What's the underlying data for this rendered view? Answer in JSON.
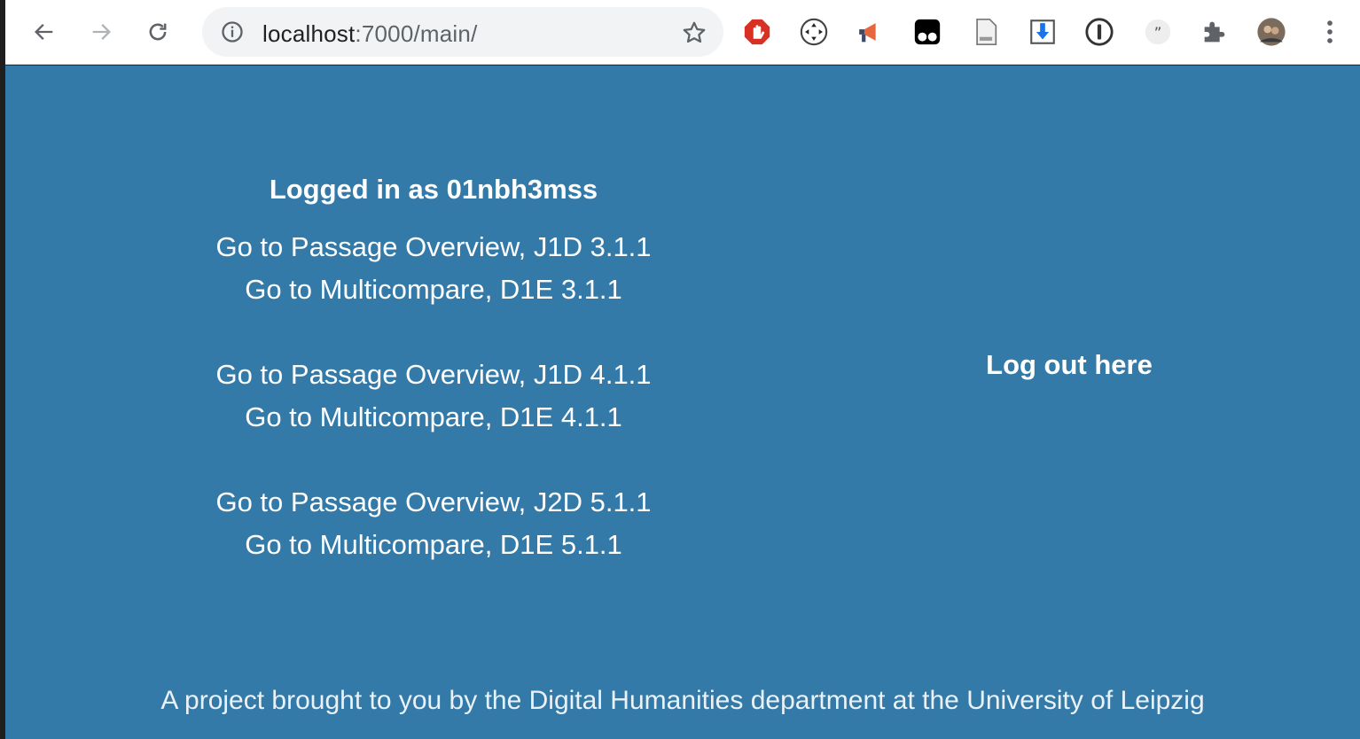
{
  "browser": {
    "url_host": "localhost",
    "url_path": ":7000/main/",
    "extensions": [
      "adblock-icon",
      "move-icon",
      "megaphone-icon",
      "tampermonkey-icon",
      "document-icon",
      "download-icon",
      "password-manager-icon",
      "quote-icon",
      "puzzle-icon",
      "profile-avatar-icon",
      "menu-icon"
    ]
  },
  "page": {
    "logged_in_text": "Logged in as 01nbh3mss",
    "link_groups": [
      {
        "passage": "Go to Passage Overview, J1D 3.1.1",
        "multicompare": "Go to Multicompare, D1E 3.1.1"
      },
      {
        "passage": "Go to Passage Overview, J1D 4.1.1",
        "multicompare": "Go to Multicompare, D1E 4.1.1"
      },
      {
        "passage": "Go to Passage Overview, J2D 5.1.1",
        "multicompare": "Go to Multicompare, D1E 5.1.1"
      }
    ],
    "logout_text": "Log out here",
    "footer_text": "A project brought to you by the Digital Humanities department at the University of Leipzig"
  },
  "colors": {
    "page_background": "#337aa8",
    "text": "#ffffff"
  }
}
